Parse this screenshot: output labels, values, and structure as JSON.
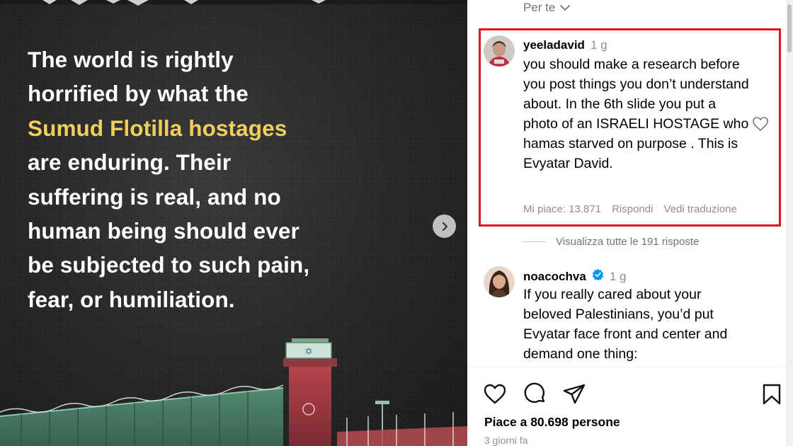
{
  "post": {
    "text_segments": [
      {
        "text": "The world is rightly horrified by what the ",
        "highlight": false
      },
      {
        "text": "Sumud Flotilla hostages",
        "highlight": true
      },
      {
        "text": " are enduring. Their suffering is real, and no human being should ever be subjected to such pain, fear, or humiliation.",
        "highlight": false
      }
    ],
    "highlight_color": "#f2cf5b",
    "next_icon": "chevron-right-icon"
  },
  "sort": {
    "label": "Per te"
  },
  "comments": [
    {
      "username": "yeeladavid",
      "time": "1 g",
      "body": "you should make a research before you post things you don’t understand about. In the 6th slide you put a photo of an ISRAELI HOSTAGE who hamas starved on purpose . This is Evyatar David.",
      "likes": "Mi piace: 13.871",
      "reply": "Rispondi",
      "translate": "Vedi traduzione",
      "verified": false
    },
    {
      "username": "noacochva",
      "time": "1 g",
      "body": "If you really cared about your beloved Palestinians, you’d put Evyatar face front and center and demand one thing:",
      "verified": true
    }
  ],
  "view_replies": "Visualizza tutte le 191 risposte",
  "highlight_box_color": "#e0141e",
  "actions": {
    "icons": [
      "heart-icon",
      "comment-icon",
      "share-icon",
      "bookmark-icon"
    ],
    "likes_text": "Piace a 80.698 persone",
    "date_text": "3 giorni fa"
  }
}
